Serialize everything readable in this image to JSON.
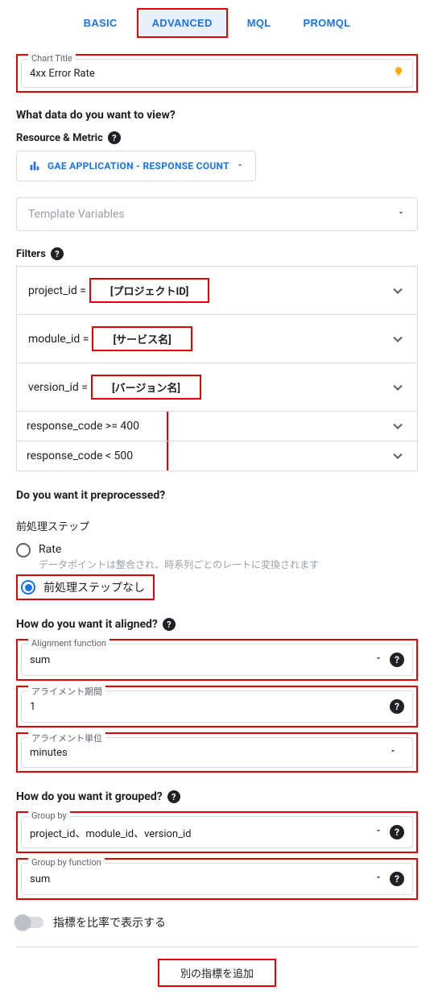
{
  "tabs": {
    "basic": "BASIC",
    "advanced": "ADVANCED",
    "mql": "MQL",
    "promql": "PROMQL"
  },
  "chartTitle": {
    "legend": "Chart Title",
    "value": "4xx Error Rate"
  },
  "headings": {
    "whatData": "What data do you want to view?",
    "resourceMetric": "Resource & Metric",
    "filters": "Filters",
    "preprocessed": "Do you want it preprocessed?",
    "preprocessStep": "前処理ステップ",
    "aligned": "How do you want it aligned?",
    "grouped": "How do you want it grouped?"
  },
  "resourceMetricValue": "GAE APPLICATION - RESPONSE COUNT",
  "templateVars": "Template Variables",
  "filtersList": [
    {
      "key": "project_id = ",
      "value": "[プロジェクトID]",
      "redbox": true
    },
    {
      "key": "module_id = ",
      "value": "[サービス名]",
      "redbox": true
    },
    {
      "key": "version_id = ",
      "value": "[バージョン名]",
      "redbox": true
    },
    {
      "key": "response_code >= 400",
      "value": "",
      "redbox": false,
      "inline": true
    },
    {
      "key": "response_code < 500",
      "value": "",
      "redbox": false,
      "inline": true
    }
  ],
  "preprocess": {
    "rate": {
      "title": "Rate",
      "desc": "データポイントは整合され、時系列ごとのレートに変換されます"
    },
    "none": {
      "title": "前処理ステップなし"
    }
  },
  "alignment": {
    "func": {
      "legend": "Alignment function",
      "value": "sum"
    },
    "period": {
      "legend": "アライメント期間",
      "value": "1"
    },
    "unit": {
      "legend": "アライメント単位",
      "value": "minutes"
    }
  },
  "group": {
    "by": {
      "legend": "Group by",
      "value": "project_id、module_id、version_id"
    },
    "func": {
      "legend": "Group by function",
      "value": "sum"
    }
  },
  "toggleLabel": "指標を比率で表示する",
  "addMetric": "別の指標を追加"
}
